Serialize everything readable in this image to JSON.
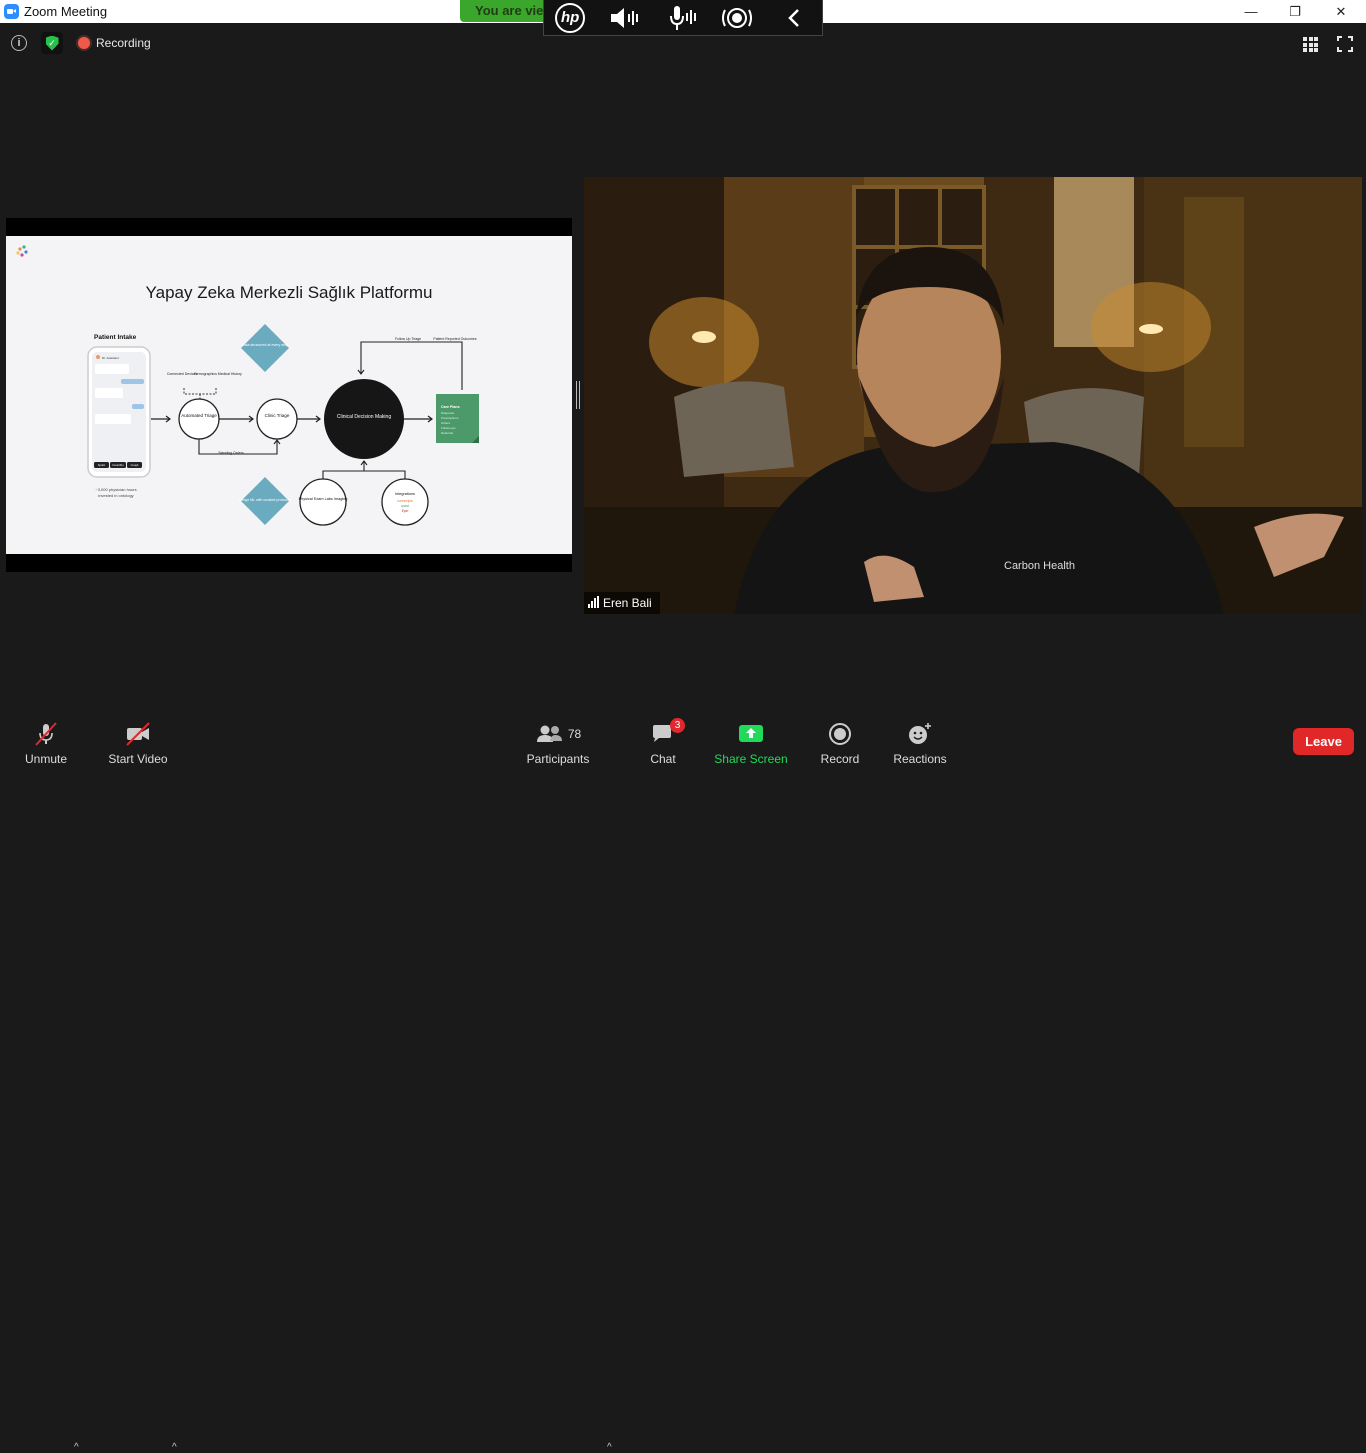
{
  "window": {
    "title": "Zoom Meeting",
    "minimize": "—",
    "restore": "❐",
    "close": "✕"
  },
  "banner": {
    "text": "You are view"
  },
  "hp_bar": {
    "logo": "hp",
    "icons": [
      "speaker-icon",
      "microphone-icon",
      "broadcast-icon",
      "chevron-left-icon"
    ]
  },
  "status": {
    "recording_label": "Recording"
  },
  "slide": {
    "title": "Yapay Zeka Merkezli Sağlık Platformu",
    "intake_title": "Patient Intake",
    "intake_caption_1": "~3,000 physician hours",
    "intake_caption_2": "invested in ontology",
    "phone_name": "Dr. Assistant",
    "phone_buttons": [
      "Sprain",
      "Fever/Flu",
      "Cough"
    ],
    "connected_devices": "Connected Devices",
    "demographics": "Demographics Medical History",
    "automated_triage": "Automated Triage",
    "standing_orders": "Standing Orders",
    "clinic_triage": "Clinic Triage",
    "data_structured": "Data structured at every step",
    "merge_ml": "Merge ML with curated protocols",
    "clinical_decision": "Clinical Decision Making",
    "follow_up": "Follow Up Triage",
    "patient_reported": "Patient Reported Outcomes",
    "care_plans_title": "Care Plans",
    "care_plans_items": [
      "Diagnosis",
      "Prescriptions",
      "Orders",
      "Follow-ups",
      "Referrals"
    ],
    "physical_exam": "Physical Exam Labs Imaging",
    "integrations": "Integrations",
    "integration_logos": [
      "surescripts",
      "quest",
      "Epic"
    ]
  },
  "video": {
    "participant_name": "Eren Bali",
    "shirt_logo": "Carbon Health"
  },
  "toolbar": {
    "unmute": "Unmute",
    "start_video": "Start Video",
    "participants": "Participants",
    "participants_count": "78",
    "chat": "Chat",
    "chat_badge": "3",
    "share_screen": "Share Screen",
    "record": "Record",
    "reactions": "Reactions",
    "leave": "Leave"
  },
  "colors": {
    "share_green": "#23d959",
    "leave_red": "#e02828",
    "banner_green": "#3aa62b",
    "diamond_teal": "#6aabc0",
    "care_plan_green": "#4c9a6a"
  }
}
